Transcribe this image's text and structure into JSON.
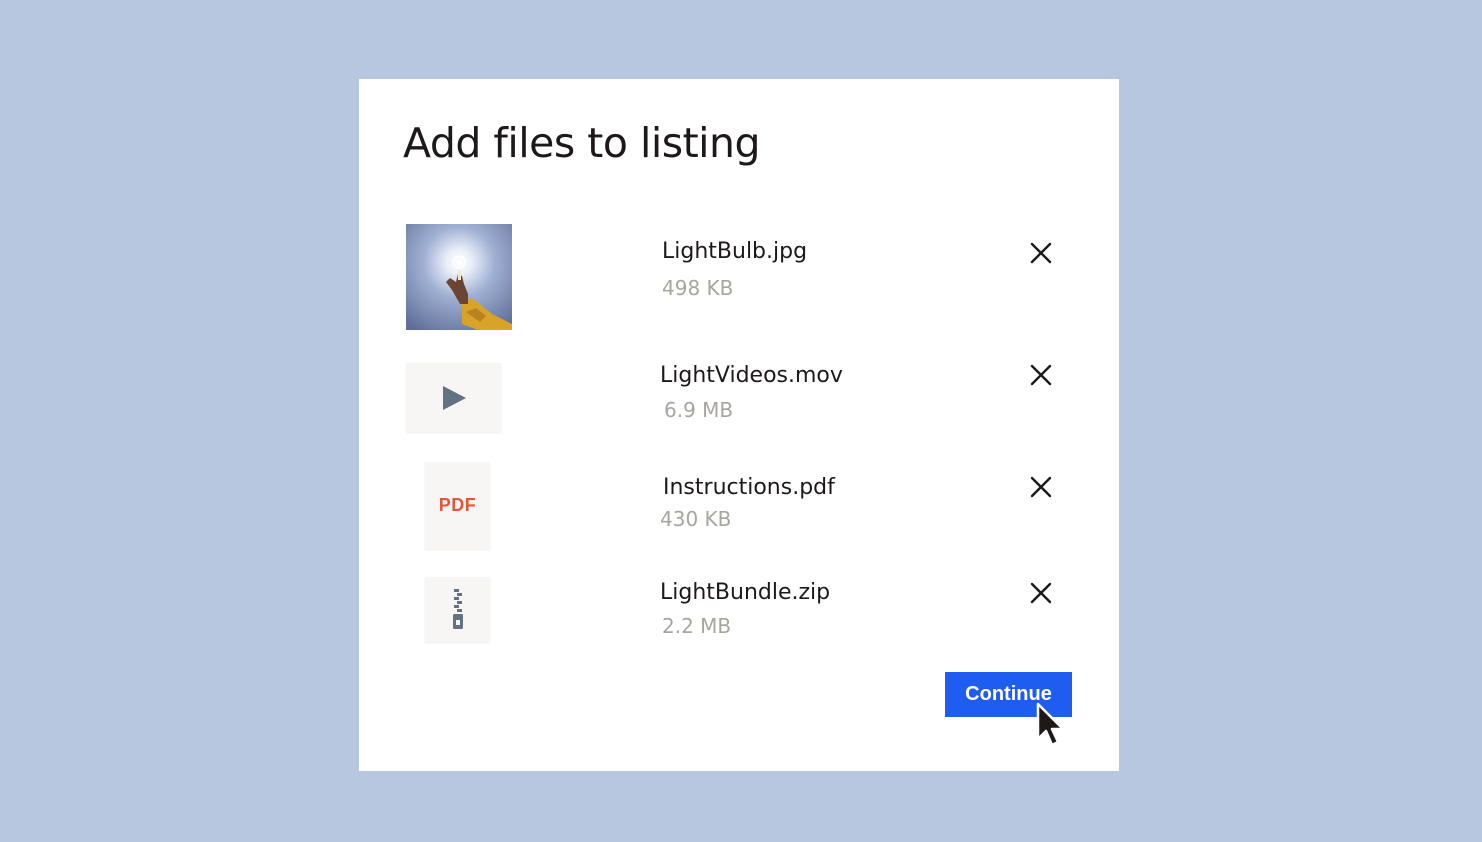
{
  "dialog": {
    "title": "Add files to listing",
    "files": [
      {
        "name": "LightBulb.jpg",
        "size": "498 KB",
        "icon": "image-thumbnail"
      },
      {
        "name": "LightVideos.mov",
        "size": "6.9 MB",
        "icon": "play-icon"
      },
      {
        "name": "Instructions.pdf",
        "size": "430 KB",
        "icon": "pdf-icon",
        "badge": "PDF"
      },
      {
        "name": "LightBundle.zip",
        "size": "2.2 MB",
        "icon": "zip-icon"
      }
    ],
    "remove_icon": "close-icon",
    "continue_label": "Continue"
  },
  "colors": {
    "background": "#b7c7e0",
    "primary_button": "#1f5df1",
    "pdf_accent": "#e0573a",
    "muted_text": "#a8a4a0"
  }
}
